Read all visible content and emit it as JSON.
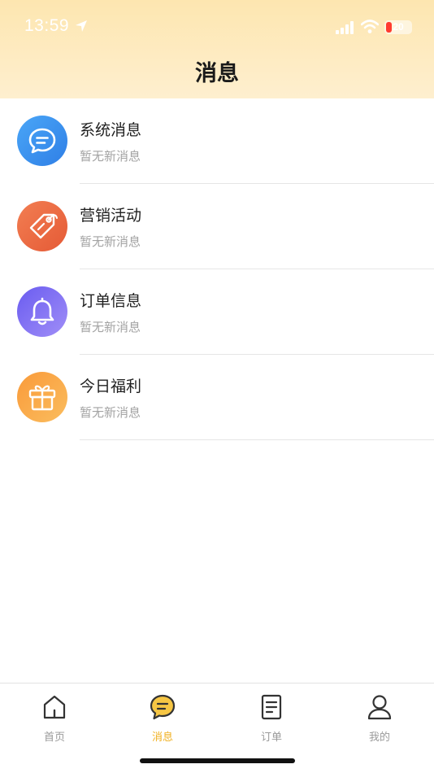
{
  "status_bar": {
    "time": "13:59",
    "battery": "20",
    "battery_color": "#ff3b30"
  },
  "header": {
    "title": "消息"
  },
  "messages": [
    {
      "title": "系统消息",
      "subtitle": "暂无新消息",
      "icon": "chat-bubble-icon",
      "color": "#3a8ff0"
    },
    {
      "title": "营销活动",
      "subtitle": "暂无新消息",
      "icon": "price-tag-icon",
      "color": "#ec6840"
    },
    {
      "title": "订单信息",
      "subtitle": "暂无新消息",
      "icon": "bell-icon",
      "color": "#7b6cf0"
    },
    {
      "title": "今日福利",
      "subtitle": "暂无新消息",
      "icon": "gift-icon",
      "color": "#f7a440"
    }
  ],
  "tabbar": {
    "active_color": "#f0b020",
    "tabs": [
      {
        "label": "首页",
        "icon": "home-icon",
        "active": false
      },
      {
        "label": "消息",
        "icon": "message-icon",
        "active": true
      },
      {
        "label": "订单",
        "icon": "order-document-icon",
        "active": false
      },
      {
        "label": "我的",
        "icon": "user-icon",
        "active": false
      }
    ]
  }
}
